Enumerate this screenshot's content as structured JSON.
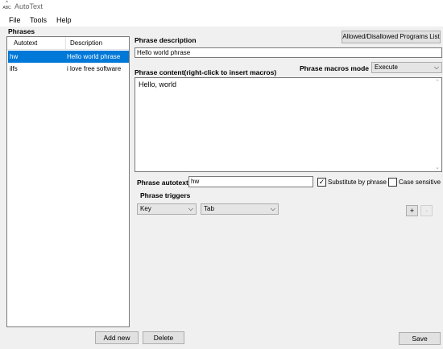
{
  "window": {
    "title": "AutoText",
    "icon_text": "ABC"
  },
  "menu": {
    "items": [
      "File",
      "Tools",
      "Help"
    ]
  },
  "phrases": {
    "label": "Phrases",
    "columns": {
      "autotext": "Autotext",
      "description": "Description"
    },
    "rows": [
      {
        "autotext": "hw",
        "description": "Hello world phrase",
        "selected": true
      },
      {
        "autotext": "ilfs",
        "description": "i love free software",
        "selected": false
      }
    ],
    "add_new_label": "Add new",
    "delete_label": "Delete"
  },
  "editor": {
    "allowed_programs_label": "Allowed/Disallowed Programs List",
    "description_label": "Phrase description",
    "description_value": "Hello world phrase",
    "content_label": "Phrase content(right-click to insert macros)",
    "macros_mode_label": "Phrase macros mode",
    "macros_mode_value": "Execute",
    "content_value": "Hello, world",
    "autotext_label": "Phrase autotext",
    "autotext_value": "hw",
    "substitute_label": "Substitute by phrase",
    "substitute_checked": true,
    "case_sensitive_label": "Case sensitive",
    "case_sensitive_checked": false,
    "triggers_label": "Phrase triggers",
    "trigger_type_value": "Key",
    "trigger_key_value": "Tab",
    "add_trigger_label": "+",
    "remove_trigger_label": "-",
    "save_label": "Save"
  },
  "icons": {
    "check": "✓",
    "chevron_down": "⌵",
    "scroll_up": "⌃",
    "scroll_down": "⌄"
  }
}
